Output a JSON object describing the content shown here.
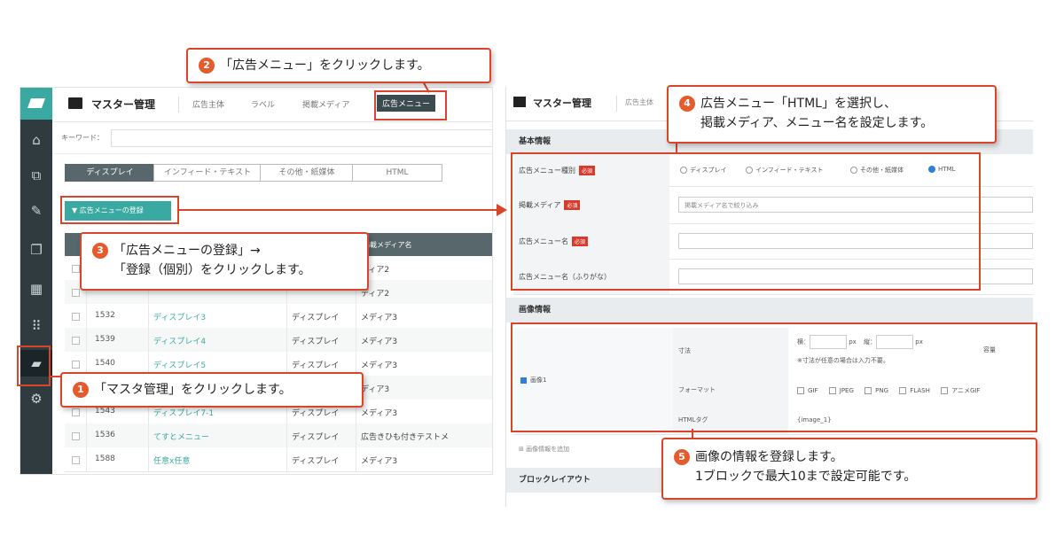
{
  "left_screen": {
    "title": "マスター管理",
    "tabs": [
      "広告主体",
      "ラベル",
      "掲載メディア",
      "広告メニュー"
    ],
    "keyword_label": "キーワード：",
    "segments": [
      "ディスプレイ",
      "インフィード・テキスト",
      "その他・紙媒体",
      "HTML"
    ],
    "register_button": "▼ 広告メニューの登録",
    "table_header_media": "掲載メディア名",
    "rows": [
      {
        "id": "",
        "name": "",
        "type": "",
        "media": "ディア2"
      },
      {
        "id": "",
        "name": "",
        "type": "",
        "media": "ディア2"
      },
      {
        "id": "1532",
        "name": "ディスプレイ3",
        "type": "ディスプレイ",
        "media": "メディア3"
      },
      {
        "id": "1539",
        "name": "ディスプレイ4",
        "type": "ディスプレイ",
        "media": "メディア3"
      },
      {
        "id": "1540",
        "name": "ディスプレイ5",
        "type": "ディスプレイ",
        "media": "メディア3"
      },
      {
        "id": "",
        "name": "",
        "type": "",
        "media": "ディア3"
      },
      {
        "id": "1543",
        "name": "ディスプレイ7-1",
        "type": "ディスプレイ",
        "media": "メディア3"
      },
      {
        "id": "1536",
        "name": "てすとメニュー",
        "type": "ディスプレイ",
        "media": "広告きひも付きテストメ"
      },
      {
        "id": "1588",
        "name": "任意x任意",
        "type": "ディスプレイ",
        "media": "メディア3"
      }
    ]
  },
  "right_screen": {
    "title": "マスター管理",
    "tab": "広告主体",
    "section_basic": "基本情報",
    "fields": {
      "menu_type_label": "広告メニュー種別",
      "menu_type_options": [
        "ディスプレイ",
        "インフィード・テキスト",
        "その他・紙媒体",
        "HTML"
      ],
      "media_label": "掲載メディア",
      "media_placeholder": "掲載メディア名で絞り込み",
      "name_label": "広告メニュー名",
      "kana_label": "広告メニュー名（ふりがな）",
      "required": "必須"
    },
    "section_image": "画像情報",
    "image": {
      "checkbox_label": "画像1",
      "size_label": "寸法",
      "width_label": "横：",
      "height_label": "縦：",
      "unit": "px",
      "size_note": "※寸法が任意の場合は入力不要。",
      "capacity_label": "容量",
      "format_label": "フォーマット",
      "formats": [
        "GIF",
        "JPEG",
        "PNG",
        "FLASH",
        "アニメGIF"
      ],
      "html_tag_label": "HTMLタグ",
      "html_tag_value": "{image_1}",
      "add_link": "画像情報を追加"
    },
    "section_layout": "ブロックレイアウト"
  },
  "callouts": {
    "c1_num": "1",
    "c1_text": "「マスタ管理」をクリックします。",
    "c2_num": "2",
    "c2_text": "「広告メニュー」をクリックします。",
    "c3_num": "3",
    "c3_line1": "「広告メニューの登録」→",
    "c3_line2": "「登録（個別）をクリックします。",
    "c4_num": "4",
    "c4_line1": "広告メニュー「HTML」を選択し、",
    "c4_line2": "掲載メディア、メニュー名を設定します。",
    "c5_num": "5",
    "c5_line1": "画像の情報を登録します。",
    "c5_line2": "1ブロックで最大10まで設定可能です。"
  },
  "colors": {
    "accent": "#d9452b",
    "teal": "#3aa9a2",
    "sidebar": "#2f3b3f"
  }
}
